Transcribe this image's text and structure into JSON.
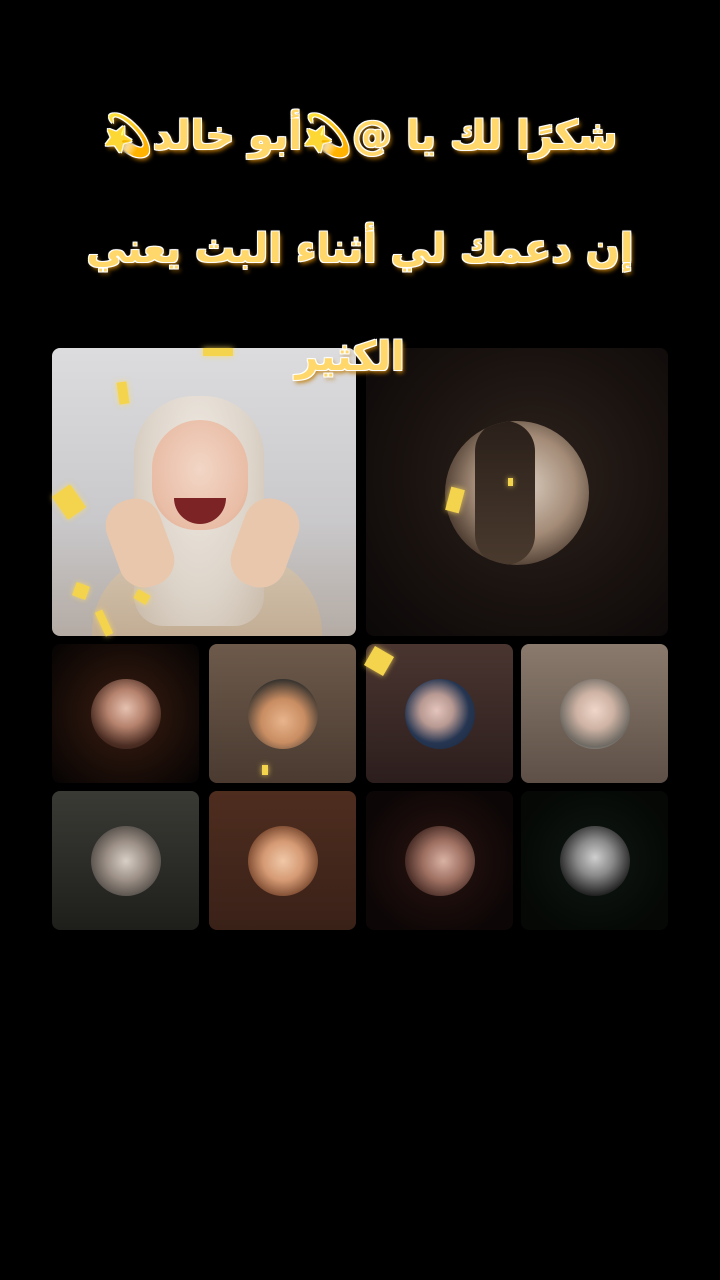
{
  "captions": {
    "line1": "شكرًا لك يا @💫أبو خالد💫",
    "line2": "إن دعمك لي أثناء البث يعني",
    "line3": "الكثير"
  },
  "participants": {
    "host": "host-video",
    "co_host": "co-host-avatar",
    "guests": [
      {
        "avatar": "guest-avatar-1"
      },
      {
        "avatar": "guest-avatar-2"
      },
      {
        "avatar": "guest-avatar-3"
      },
      {
        "avatar": "guest-avatar-4"
      },
      {
        "avatar": "guest-avatar-5"
      },
      {
        "avatar": "guest-avatar-6"
      },
      {
        "avatar": "guest-avatar-7"
      },
      {
        "avatar": "guest-avatar-8"
      }
    ]
  },
  "colors": {
    "background": "#000000",
    "caption_text": "#ffd76a",
    "confetti": "#f4d44c"
  }
}
